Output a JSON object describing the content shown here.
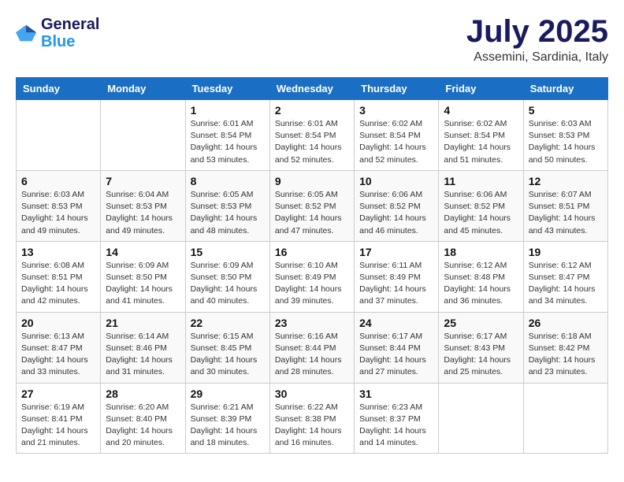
{
  "logo": {
    "text_general": "General",
    "text_blue": "Blue"
  },
  "header": {
    "month": "July 2025",
    "location": "Assemini, Sardinia, Italy"
  },
  "weekdays": [
    "Sunday",
    "Monday",
    "Tuesday",
    "Wednesday",
    "Thursday",
    "Friday",
    "Saturday"
  ],
  "weeks": [
    [
      {
        "day": "",
        "content": ""
      },
      {
        "day": "",
        "content": ""
      },
      {
        "day": "1",
        "content": "Sunrise: 6:01 AM\nSunset: 8:54 PM\nDaylight: 14 hours and 53 minutes."
      },
      {
        "day": "2",
        "content": "Sunrise: 6:01 AM\nSunset: 8:54 PM\nDaylight: 14 hours and 52 minutes."
      },
      {
        "day": "3",
        "content": "Sunrise: 6:02 AM\nSunset: 8:54 PM\nDaylight: 14 hours and 52 minutes."
      },
      {
        "day": "4",
        "content": "Sunrise: 6:02 AM\nSunset: 8:54 PM\nDaylight: 14 hours and 51 minutes."
      },
      {
        "day": "5",
        "content": "Sunrise: 6:03 AM\nSunset: 8:53 PM\nDaylight: 14 hours and 50 minutes."
      }
    ],
    [
      {
        "day": "6",
        "content": "Sunrise: 6:03 AM\nSunset: 8:53 PM\nDaylight: 14 hours and 49 minutes."
      },
      {
        "day": "7",
        "content": "Sunrise: 6:04 AM\nSunset: 8:53 PM\nDaylight: 14 hours and 49 minutes."
      },
      {
        "day": "8",
        "content": "Sunrise: 6:05 AM\nSunset: 8:53 PM\nDaylight: 14 hours and 48 minutes."
      },
      {
        "day": "9",
        "content": "Sunrise: 6:05 AM\nSunset: 8:52 PM\nDaylight: 14 hours and 47 minutes."
      },
      {
        "day": "10",
        "content": "Sunrise: 6:06 AM\nSunset: 8:52 PM\nDaylight: 14 hours and 46 minutes."
      },
      {
        "day": "11",
        "content": "Sunrise: 6:06 AM\nSunset: 8:52 PM\nDaylight: 14 hours and 45 minutes."
      },
      {
        "day": "12",
        "content": "Sunrise: 6:07 AM\nSunset: 8:51 PM\nDaylight: 14 hours and 43 minutes."
      }
    ],
    [
      {
        "day": "13",
        "content": "Sunrise: 6:08 AM\nSunset: 8:51 PM\nDaylight: 14 hours and 42 minutes."
      },
      {
        "day": "14",
        "content": "Sunrise: 6:09 AM\nSunset: 8:50 PM\nDaylight: 14 hours and 41 minutes."
      },
      {
        "day": "15",
        "content": "Sunrise: 6:09 AM\nSunset: 8:50 PM\nDaylight: 14 hours and 40 minutes."
      },
      {
        "day": "16",
        "content": "Sunrise: 6:10 AM\nSunset: 8:49 PM\nDaylight: 14 hours and 39 minutes."
      },
      {
        "day": "17",
        "content": "Sunrise: 6:11 AM\nSunset: 8:49 PM\nDaylight: 14 hours and 37 minutes."
      },
      {
        "day": "18",
        "content": "Sunrise: 6:12 AM\nSunset: 8:48 PM\nDaylight: 14 hours and 36 minutes."
      },
      {
        "day": "19",
        "content": "Sunrise: 6:12 AM\nSunset: 8:47 PM\nDaylight: 14 hours and 34 minutes."
      }
    ],
    [
      {
        "day": "20",
        "content": "Sunrise: 6:13 AM\nSunset: 8:47 PM\nDaylight: 14 hours and 33 minutes."
      },
      {
        "day": "21",
        "content": "Sunrise: 6:14 AM\nSunset: 8:46 PM\nDaylight: 14 hours and 31 minutes."
      },
      {
        "day": "22",
        "content": "Sunrise: 6:15 AM\nSunset: 8:45 PM\nDaylight: 14 hours and 30 minutes."
      },
      {
        "day": "23",
        "content": "Sunrise: 6:16 AM\nSunset: 8:44 PM\nDaylight: 14 hours and 28 minutes."
      },
      {
        "day": "24",
        "content": "Sunrise: 6:17 AM\nSunset: 8:44 PM\nDaylight: 14 hours and 27 minutes."
      },
      {
        "day": "25",
        "content": "Sunrise: 6:17 AM\nSunset: 8:43 PM\nDaylight: 14 hours and 25 minutes."
      },
      {
        "day": "26",
        "content": "Sunrise: 6:18 AM\nSunset: 8:42 PM\nDaylight: 14 hours and 23 minutes."
      }
    ],
    [
      {
        "day": "27",
        "content": "Sunrise: 6:19 AM\nSunset: 8:41 PM\nDaylight: 14 hours and 21 minutes."
      },
      {
        "day": "28",
        "content": "Sunrise: 6:20 AM\nSunset: 8:40 PM\nDaylight: 14 hours and 20 minutes."
      },
      {
        "day": "29",
        "content": "Sunrise: 6:21 AM\nSunset: 8:39 PM\nDaylight: 14 hours and 18 minutes."
      },
      {
        "day": "30",
        "content": "Sunrise: 6:22 AM\nSunset: 8:38 PM\nDaylight: 14 hours and 16 minutes."
      },
      {
        "day": "31",
        "content": "Sunrise: 6:23 AM\nSunset: 8:37 PM\nDaylight: 14 hours and 14 minutes."
      },
      {
        "day": "",
        "content": ""
      },
      {
        "day": "",
        "content": ""
      }
    ]
  ]
}
